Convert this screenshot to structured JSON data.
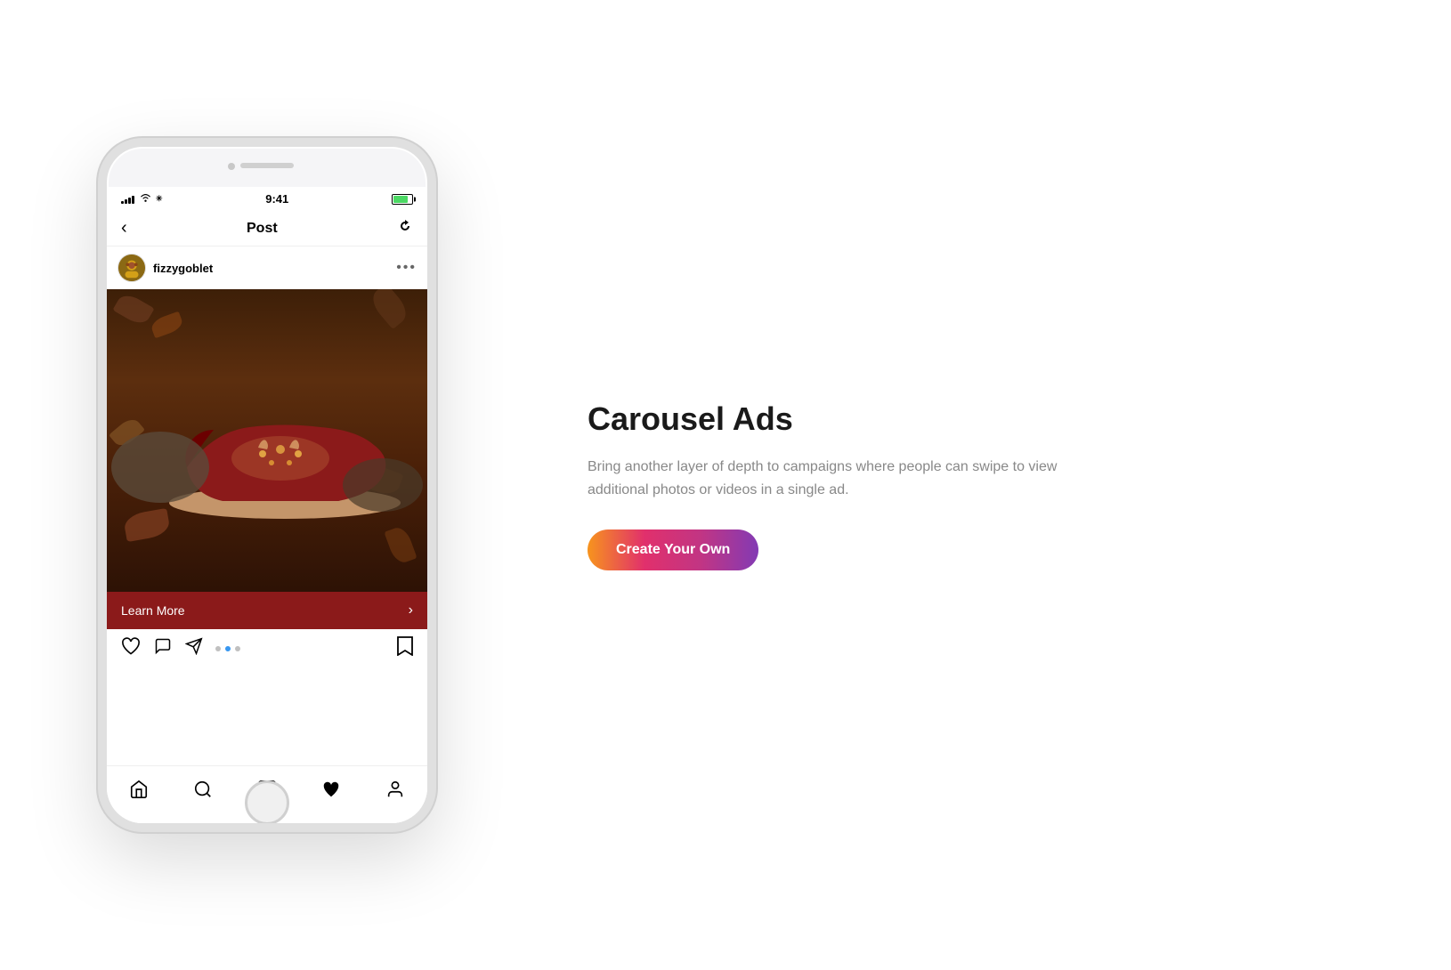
{
  "page": {
    "background": "#ffffff"
  },
  "phone": {
    "status_bar": {
      "time": "9:41",
      "signal_bars": [
        3,
        5,
        7,
        9,
        11
      ],
      "wifi_symbol": "wifi",
      "battery_percent": 80
    },
    "nav": {
      "title": "Post",
      "back_label": "‹",
      "refresh_label": "↻"
    },
    "post": {
      "username": "fizzygoblet",
      "more_label": "•••",
      "learn_more_label": "Learn More"
    },
    "carousel_dots": [
      "inactive",
      "active",
      "inactive"
    ],
    "bottom_nav": {
      "items": [
        "home",
        "search",
        "add",
        "heart",
        "profile"
      ]
    }
  },
  "content": {
    "title": "Carousel Ads",
    "description": "Bring another layer of depth to campaigns where people can swipe to view additional photos or videos in a single ad.",
    "cta_label": "Create Your Own"
  }
}
